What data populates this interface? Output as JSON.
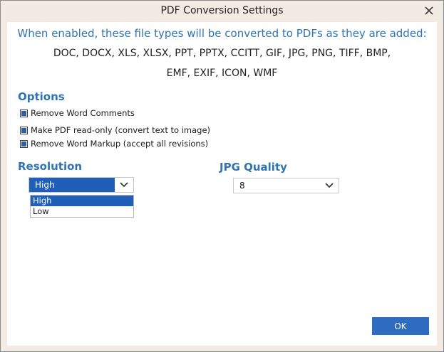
{
  "window": {
    "title": "PDF Conversion Settings",
    "close_icon": "close-icon"
  },
  "intro": {
    "text": "When enabled, these file types will be converted to PDFs as they are added:",
    "filetypes": "DOC, DOCX, XLS, XLSX, PPT, PPTX, CCITT, GIF, JPG, PNG, TIFF, BMP, EMF, EXIF, ICON, WMF"
  },
  "options": {
    "heading": "Options",
    "items": [
      {
        "label": "Remove Word Comments",
        "checked": true
      },
      {
        "label": "Make PDF read-only (convert text to image)",
        "checked": true
      },
      {
        "label": "Remove Word Markup (accept all revisions)",
        "checked": true
      }
    ]
  },
  "resolution": {
    "heading": "Resolution",
    "selected": "High",
    "options": [
      "High",
      "Low"
    ],
    "highlighted": "High"
  },
  "jpg_quality": {
    "heading": "JPG Quality",
    "selected": "8"
  },
  "buttons": {
    "ok": "OK"
  },
  "colors": {
    "accent": "#2e74b5",
    "selection": "#1f5fb7",
    "button": "#2d6cc1",
    "window_frame": "#f2ebe4"
  }
}
